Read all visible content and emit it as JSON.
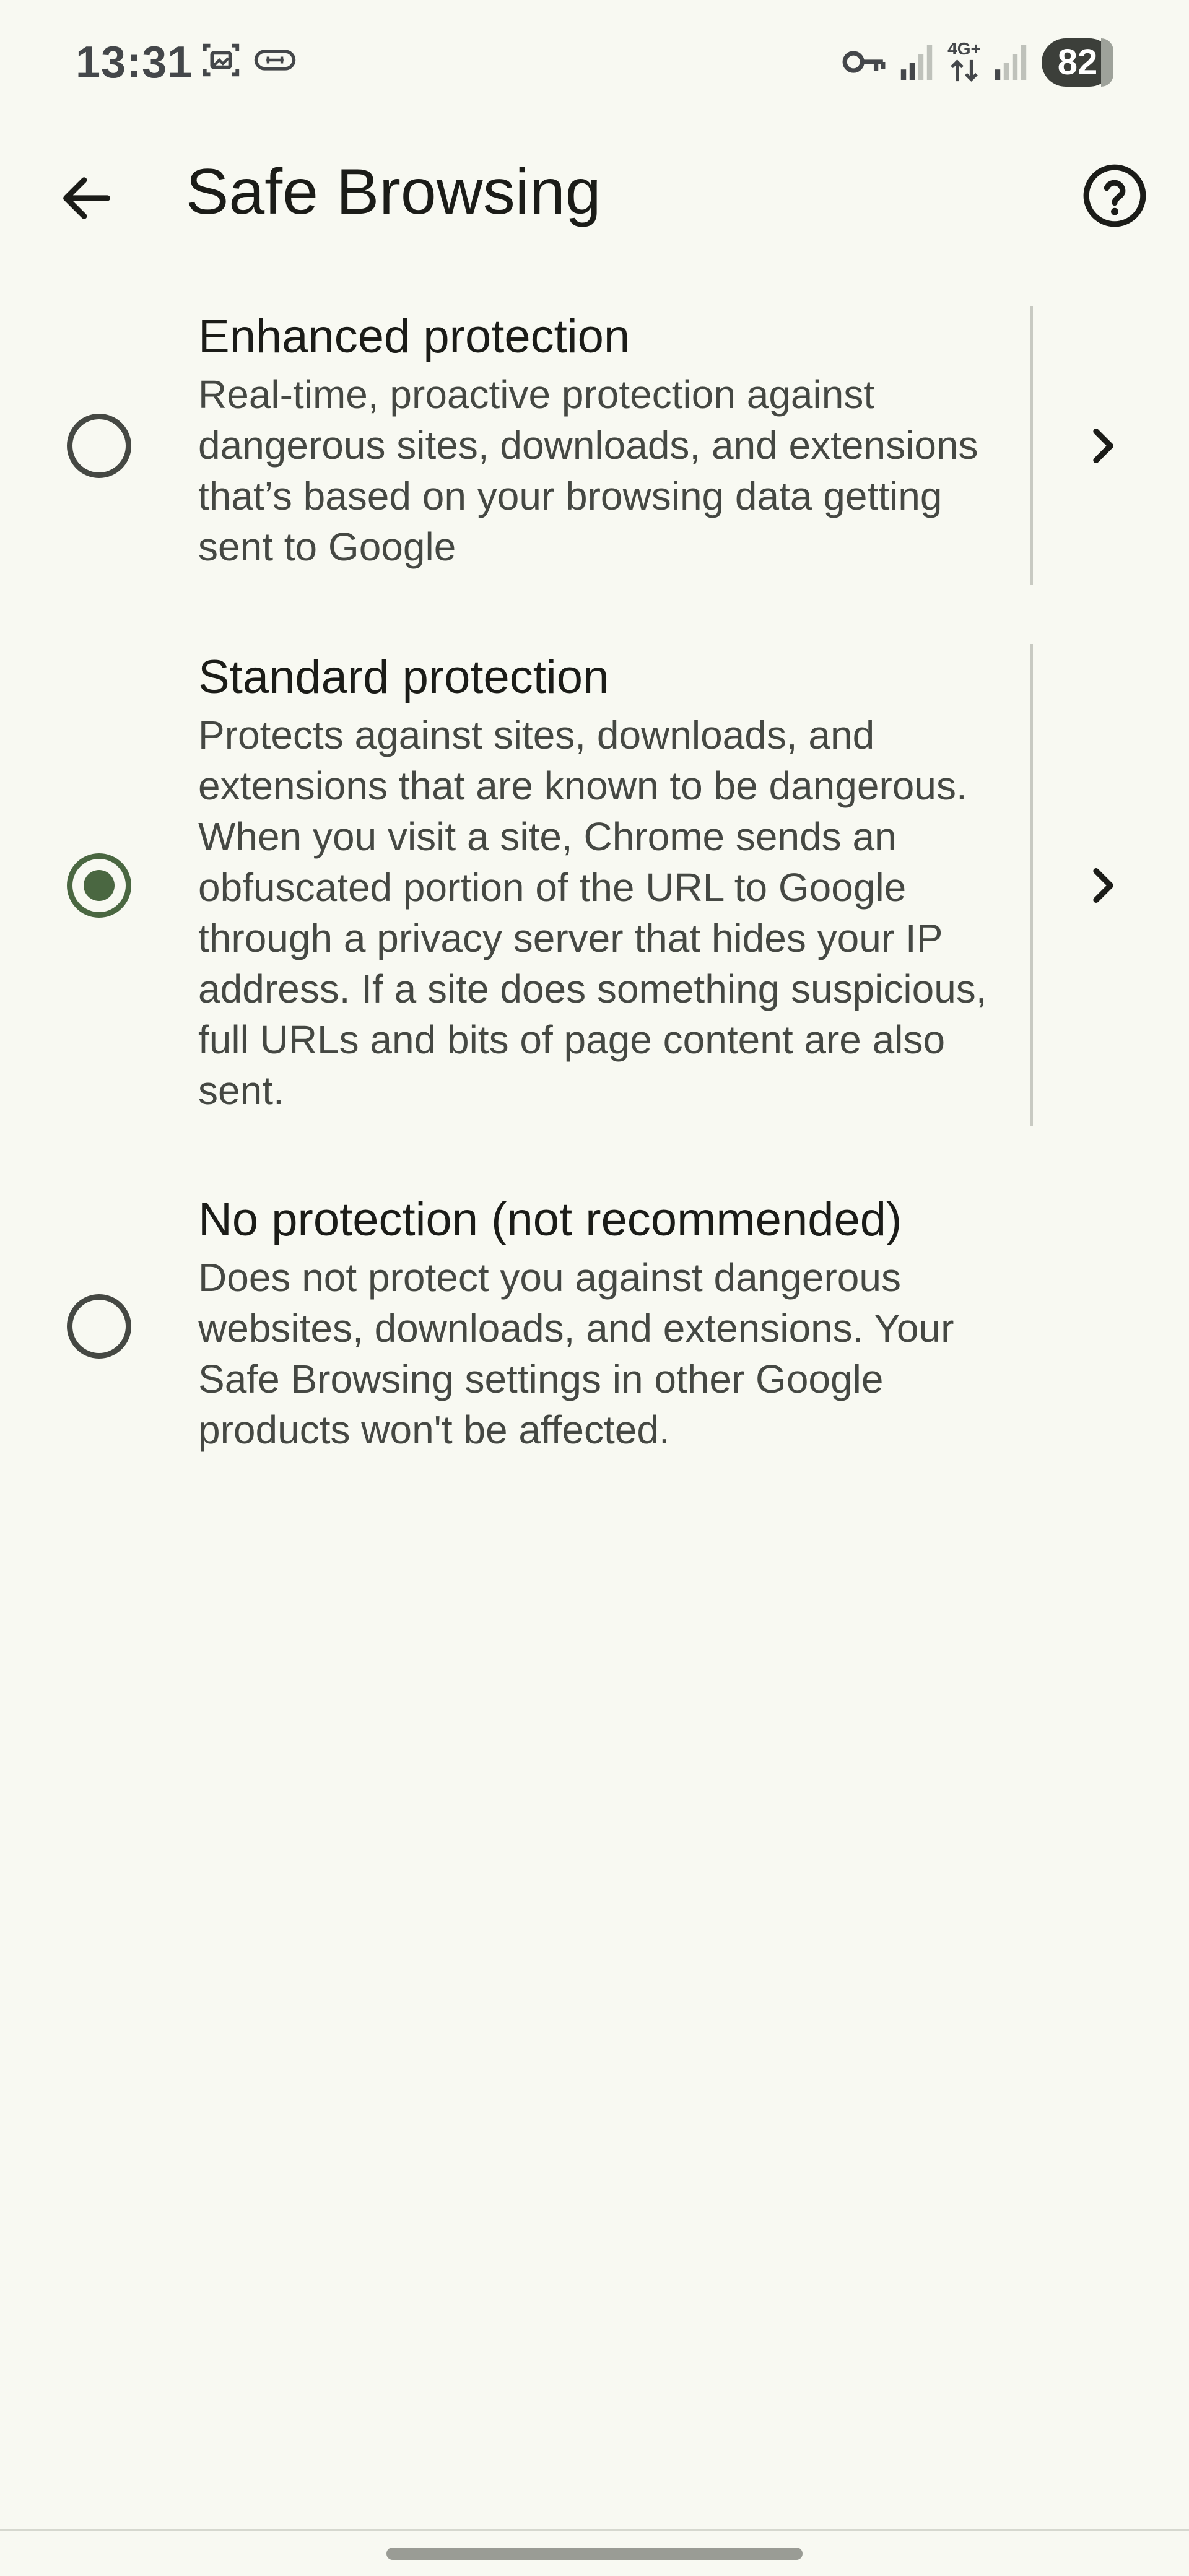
{
  "status_bar": {
    "time": "13:31",
    "icons": [
      "screenshot-icon",
      "link-icon",
      "vpn-key-icon",
      "signal-icon",
      "network-4g-icon",
      "signal-icon-2"
    ],
    "network_label": "4G+",
    "battery": "82"
  },
  "app_bar": {
    "title": "Safe Browsing",
    "back_icon": "arrow-back-icon",
    "help_icon": "help-circle-icon"
  },
  "options": [
    {
      "title": "Enhanced protection",
      "description": "Real-time, proactive protection against dangerous sites, downloads, and extensions that’s based on your browsing data getting sent to Google",
      "selected": false
    },
    {
      "title": "Standard protection",
      "description": "Protects against sites, downloads, and extensions that are known to be dangerous. When you visit a site, Chrome sends an obfuscated portion of the URL to Google through a privacy server that hides your IP address. If a site does something suspicious, full URLs and bits of page content are also sent.",
      "selected": true
    },
    {
      "title": "No protection (not recommended)",
      "description": "Does not protect you against dangerous websites, downloads, and extensions. Your Safe Browsing settings in other Google products won't be affected.",
      "selected": false
    }
  ],
  "colors": {
    "background": "#f8f9f2",
    "accent": "#4a6741",
    "text_primary": "#1b1c18",
    "text_secondary": "#454843"
  }
}
